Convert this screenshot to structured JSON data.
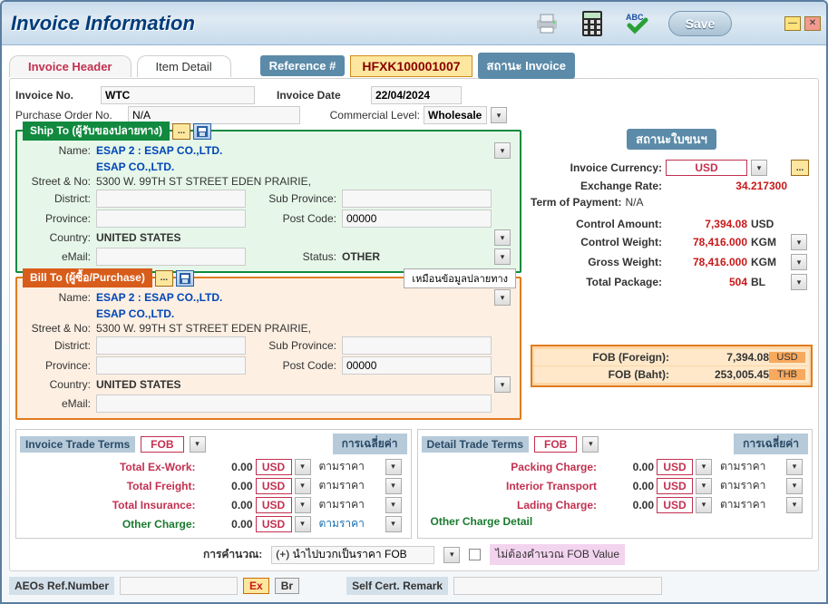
{
  "window": {
    "title": "Invoice Information"
  },
  "toolbar": {
    "save": "Save"
  },
  "tabs": {
    "header": "Invoice Header",
    "detail": "Item Detail"
  },
  "ref": {
    "label": "Reference #",
    "value": "HFXK100001007",
    "status_label": "สถานะ Invoice"
  },
  "hdr": {
    "invoice_no_lbl": "Invoice No.",
    "invoice_no": "WTC",
    "invoice_date_lbl": "Invoice Date",
    "invoice_date": "22/04/2024",
    "po_lbl": "Purchase Order No.",
    "po": "N/A",
    "com_lvl_lbl": "Commercial Level:",
    "com_lvl": "Wholesale"
  },
  "ship": {
    "title": "Ship To (ผู้รับของปลายทาง)",
    "name_lbl": "Name:",
    "name1": "ESAP 2 : ESAP CO.,LTD.",
    "name2": "ESAP CO.,LTD.",
    "street_lbl": "Street & No:",
    "street": "5300 W. 99TH ST STREET EDEN PRAIRIE,",
    "district_lbl": "District:",
    "district": "",
    "subprov_lbl": "Sub Province:",
    "subprov": "",
    "province_lbl": "Province:",
    "province": "",
    "post_lbl": "Post Code:",
    "post": "00000",
    "country_lbl": "Country:",
    "country": "UNITED STATES",
    "email_lbl": "eMail:",
    "email": "",
    "status_lbl": "Status:",
    "status": "OTHER"
  },
  "bill": {
    "title": "Bill To (ผู้ซื้อ/Purchase)",
    "copy_btn": "เหมือนข้อมูลปลายทาง",
    "name_lbl": "Name:",
    "name1": "ESAP 2 : ESAP CO.,LTD.",
    "name2": "ESAP CO.,LTD.",
    "street_lbl": "Street & No:",
    "street": "5300 W. 99TH ST STREET EDEN PRAIRIE,",
    "district_lbl": "District:",
    "district": "",
    "subprov_lbl": "Sub Province:",
    "subprov": "",
    "province_lbl": "Province:",
    "province": "",
    "post_lbl": "Post Code:",
    "post": "00000",
    "country_lbl": "Country:",
    "country": "UNITED STATES",
    "email_lbl": "eMail:",
    "email": ""
  },
  "side": {
    "status_hdr": "สถานะใบขนฯ",
    "inv_cur_lbl": "Invoice Currency:",
    "inv_cur": "USD",
    "exrate_lbl": "Exchange Rate:",
    "exrate": "34.217300",
    "terms_lbl": "Term of Payment:",
    "terms": "N/A",
    "ctrl_amt_lbl": "Control Amount:",
    "ctrl_amt": "7,394.08",
    "ctrl_amt_u": "USD",
    "ctrl_wt_lbl": "Control Weight:",
    "ctrl_wt": "78,416.000",
    "ctrl_wt_u": "KGM",
    "gross_wt_lbl": "Gross Weight:",
    "gross_wt": "78,416.000",
    "gross_wt_u": "KGM",
    "tot_pkg_lbl": "Total Package:",
    "tot_pkg": "504",
    "tot_pkg_u": "BL",
    "fob_f_lbl": "FOB (Foreign):",
    "fob_f": "7,394.08",
    "fob_f_u": "USD",
    "fob_b_lbl": "FOB (Baht):",
    "fob_b": "253,005.45",
    "fob_b_u": "THB"
  },
  "trade_inv": {
    "title": "Invoice Trade Terms",
    "term": "FOB",
    "avg": "การเฉลี่ยค่า",
    "exwork_lbl": "Total Ex-Work:",
    "exwork": "0.00",
    "exwork_u": "USD",
    "exwork_b": "ตามราคา",
    "freight_lbl": "Total Freight:",
    "freight": "0.00",
    "freight_u": "USD",
    "freight_b": "ตามราคา",
    "ins_lbl": "Total Insurance:",
    "ins": "0.00",
    "ins_u": "USD",
    "ins_b": "ตามราคา",
    "other_lbl": "Other Charge:",
    "other": "0.00",
    "other_u": "USD",
    "other_b": "ตามราคา"
  },
  "trade_det": {
    "title": "Detail Trade Terms",
    "term": "FOB",
    "avg": "การเฉลี่ยค่า",
    "pack_lbl": "Packing Charge:",
    "pack": "0.00",
    "pack_u": "USD",
    "pack_b": "ตามราคา",
    "int_lbl": "Interior Transport",
    "int": "0.00",
    "int_u": "USD",
    "int_b": "ตามราคา",
    "lad_lbl": "Lading Charge:",
    "lad": "0.00",
    "lad_u": "USD",
    "lad_b": "ตามราคา",
    "other_d_lbl": "Other Charge Detail"
  },
  "calc": {
    "lbl": "การคำนวณ:",
    "method": "(+) นำไปบวกเป็นราคา FOB",
    "nofob": "ไม่ต้องคำนวณ FOB Value"
  },
  "footer": {
    "aeo_lbl": "AEOs Ref.Number",
    "aeo": "",
    "ex": "Ex",
    "br": "Br",
    "sc_lbl": "Self Cert. Remark",
    "sc": ""
  },
  "icons": {
    "dots": "...",
    "dash": "—",
    "x": "✕",
    "down": "▾"
  }
}
